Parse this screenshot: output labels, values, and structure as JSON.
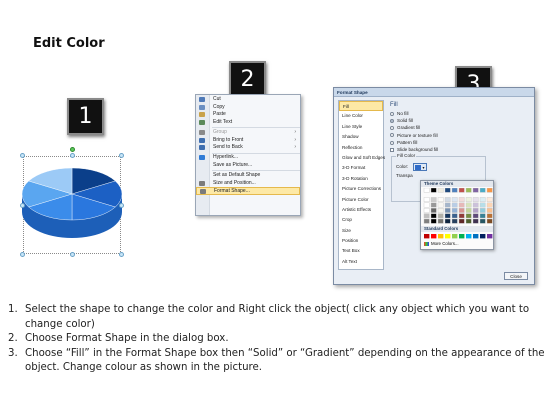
{
  "slide_title": "Edit Color",
  "badges": [
    "1",
    "2",
    "3"
  ],
  "pie": {
    "slice_colors": [
      "#0b3f8a",
      "#1c60c4",
      "#2a77de",
      "#3b8cea",
      "#5aa6f0",
      "#9ccaf6"
    ],
    "side_color": "#1d5fb8"
  },
  "context_menu": {
    "items": [
      {
        "label": "Cut",
        "icon": "scissors-icon",
        "disabled": false,
        "submenu": false
      },
      {
        "label": "Copy",
        "icon": "copy-icon",
        "disabled": false,
        "submenu": false
      },
      {
        "label": "Paste",
        "icon": "paste-icon",
        "disabled": false,
        "submenu": false
      },
      {
        "label": "Edit Text",
        "icon": "edit-text-icon",
        "disabled": false,
        "submenu": false
      },
      {
        "separator": true
      },
      {
        "label": "Group",
        "icon": "group-icon",
        "disabled": true,
        "submenu": true
      },
      {
        "label": "Bring to Front",
        "icon": "bring-front-icon",
        "disabled": false,
        "submenu": true
      },
      {
        "label": "Send to Back",
        "icon": "send-back-icon",
        "disabled": false,
        "submenu": true
      },
      {
        "separator": true
      },
      {
        "label": "Hyperlink...",
        "icon": "hyperlink-icon",
        "disabled": false,
        "submenu": false
      },
      {
        "label": "Save as Picture...",
        "icon": "",
        "disabled": false,
        "submenu": false
      },
      {
        "separator": true
      },
      {
        "label": "Set as Default Shape",
        "icon": "",
        "disabled": false,
        "submenu": false
      },
      {
        "label": "Size and Position...",
        "icon": "size-icon",
        "disabled": false,
        "submenu": false
      },
      {
        "label": "Format Shape...",
        "icon": "format-shape-icon",
        "disabled": false,
        "submenu": false,
        "highlighted": true
      }
    ]
  },
  "dialog": {
    "title": "Format Shape",
    "categories": [
      "Fill",
      "Line Color",
      "Line Style",
      "Shadow",
      "Reflection",
      "Glow and Soft Edges",
      "3-D Format",
      "3-D Rotation",
      "Picture Corrections",
      "Picture Color",
      "Artistic Effects",
      "Crop",
      "Size",
      "Position",
      "Text Box",
      "Alt Text"
    ],
    "selected_category": "Fill",
    "heading": "Fill",
    "options": [
      "No fill",
      "Solid fill",
      "Gradient fill",
      "Picture or texture fill",
      "Pattern fill",
      "Slide background fill"
    ],
    "selected_option": "Solid fill",
    "fill_color_label": "Fill Color",
    "color_label": "Color:",
    "transparency_label": "Transpa",
    "close_label": "Close"
  },
  "color_popup": {
    "theme_label": "Theme Colors",
    "standard_label": "Standard Colors",
    "more_label": "More Colors...",
    "theme_top": [
      "#ffffff",
      "#000000",
      "#eeece1",
      "#1f497d",
      "#4f81bd",
      "#c0504d",
      "#9bbb59",
      "#8064a2",
      "#4bacc6",
      "#f79646"
    ],
    "standard": [
      "#c00000",
      "#ff0000",
      "#ffc000",
      "#ffff00",
      "#92d050",
      "#00b050",
      "#00b0f0",
      "#0070c0",
      "#002060",
      "#7030a0"
    ]
  },
  "instructions": [
    {
      "num": "1.",
      "text": "Select the shape to change the color and Right click the object( click any object which you want to change color)"
    },
    {
      "num": "2.",
      "text": "Choose Format Shape in the dialog box."
    },
    {
      "num": "3.",
      "text": "Choose “Fill” in the Format Shape box then “Solid” or “Gradient” depending on the appearance of the object. Change colour as shown in the picture."
    }
  ]
}
